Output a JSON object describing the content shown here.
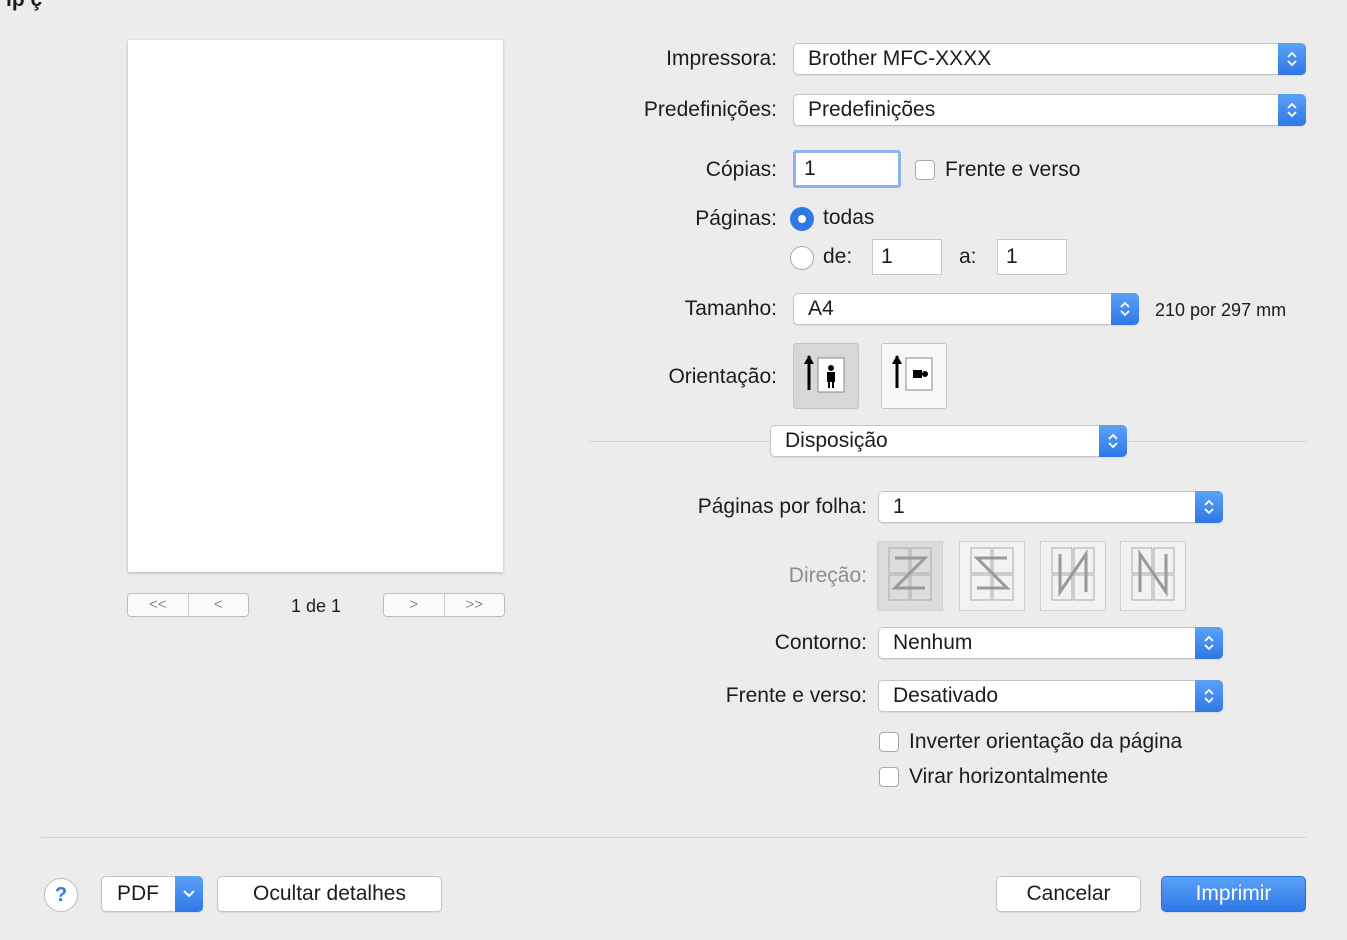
{
  "header": {
    "partial_title": "ip ç"
  },
  "preview": {
    "page_label": "1 de 1",
    "nav_first": "<<",
    "nav_prev": "<",
    "nav_next": ">",
    "nav_last": ">>"
  },
  "printer": {
    "label": "Impressora:",
    "value": "Brother MFC-XXXX"
  },
  "presets": {
    "label": "Predefinições:",
    "value": "Predefinições"
  },
  "copies": {
    "label": "Cópias:",
    "value": "1",
    "duplex_label": "Frente e verso",
    "duplex_checked": false
  },
  "pages": {
    "label": "Páginas:",
    "all_label": "todas",
    "range_from_label": "de:",
    "range_from": "1",
    "range_to_label": "a:",
    "range_to": "1",
    "selected": "todas"
  },
  "size": {
    "label": "Tamanho:",
    "value": "A4",
    "dimensions": "210 por 297 mm"
  },
  "orientation": {
    "label": "Orientação:",
    "options": [
      "portrait-icon",
      "landscape-icon"
    ],
    "selected": "portrait"
  },
  "section": {
    "value": "Disposição"
  },
  "layout": {
    "pages_per_sheet_label": "Páginas por folha:",
    "pages_per_sheet": "1",
    "direction_label": "Direção:",
    "direction_icons": [
      "z-direction-icon",
      "reverse-z-direction-icon",
      "n-direction-icon",
      "reverse-n-direction-icon"
    ],
    "border_label": "Contorno:",
    "border": "Nenhum",
    "two_sided_label": "Frente e verso:",
    "two_sided": "Desativado",
    "reverse_orientation_label": "Inverter orientação da página",
    "flip_horizontal_label": "Virar horizontalmente"
  },
  "footer": {
    "help": "?",
    "pdf": "PDF",
    "hide_details": "Ocultar detalhes",
    "cancel": "Cancelar",
    "print": "Imprimir"
  },
  "colors": {
    "accent": "#2f78e6",
    "window": "#ececec"
  }
}
